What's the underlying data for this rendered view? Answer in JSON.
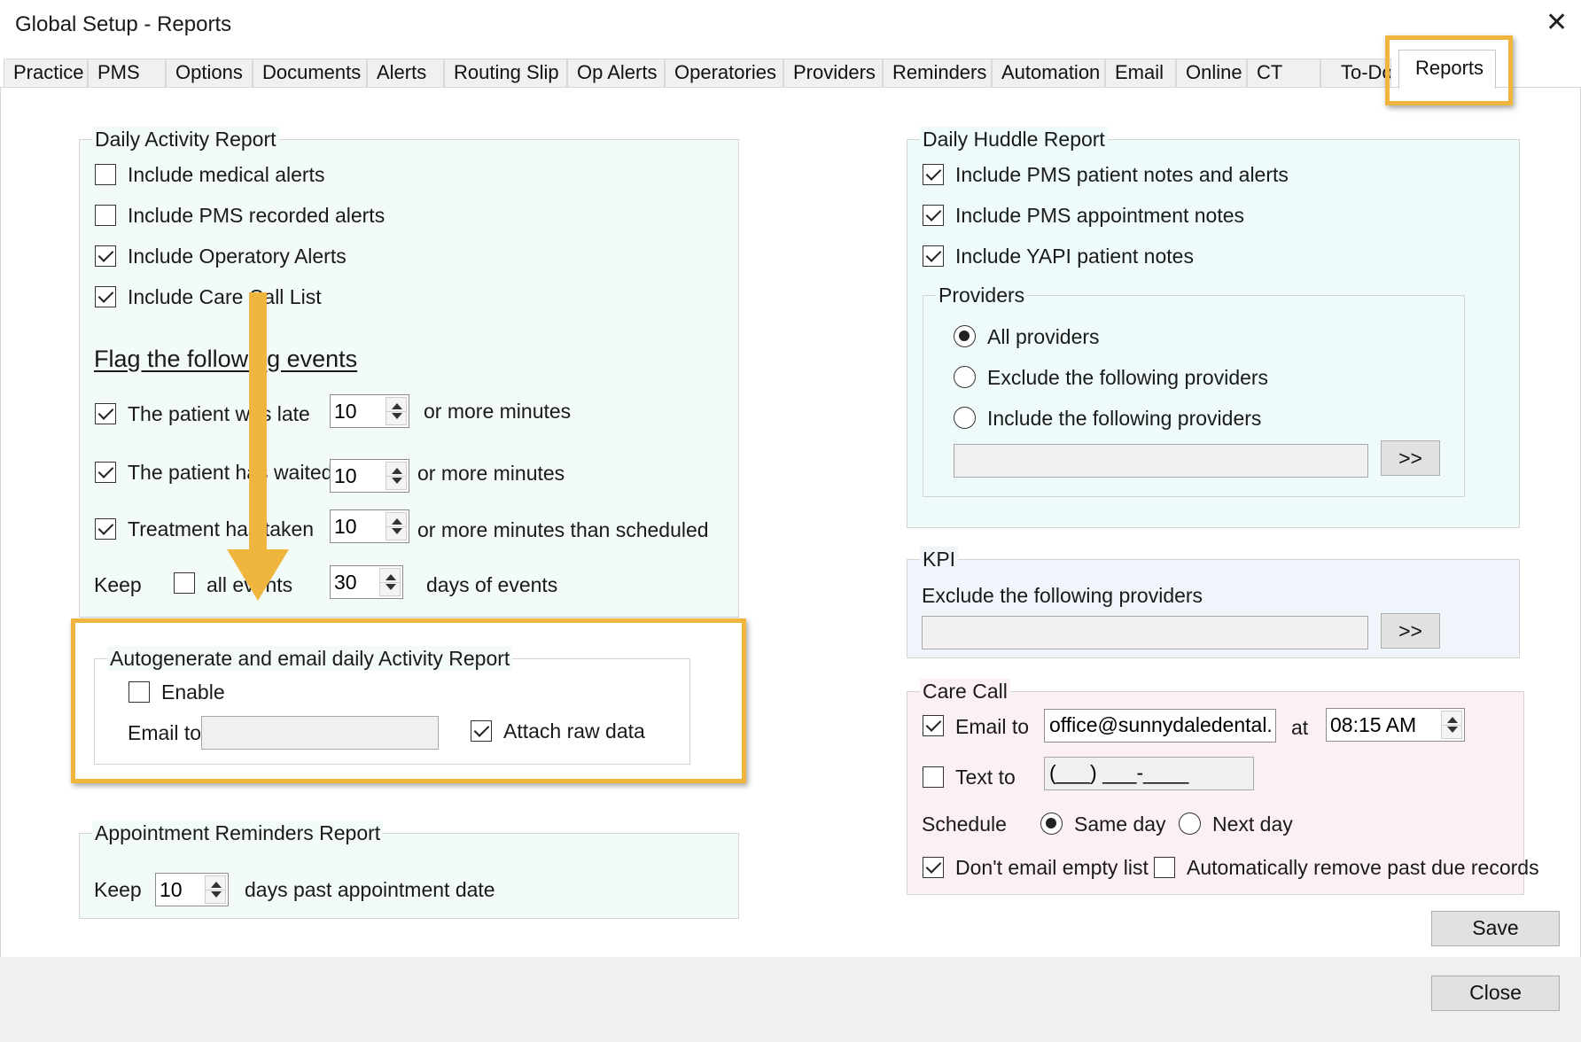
{
  "window": {
    "title": "Global Setup - Reports",
    "close_glyph": "✕"
  },
  "tabs": [
    "Practice",
    "PMS",
    "Options",
    "Documents",
    "Alerts",
    "Routing Slip",
    "Op Alerts",
    "Operatories",
    "Providers",
    "Reminders",
    "Automation",
    "Email",
    "Online",
    "CT",
    "To-Do",
    "Reports"
  ],
  "active_tab": "Reports",
  "daily_activity": {
    "legend": "Daily Activity Report",
    "checks": [
      {
        "label": "Include medical alerts",
        "checked": false
      },
      {
        "label": "Include PMS recorded alerts",
        "checked": false
      },
      {
        "label": "Include Operatory Alerts",
        "checked": true
      },
      {
        "label": "Include Care Call List",
        "checked": true
      }
    ],
    "flag_heading": "Flag the following events",
    "events": [
      {
        "label": "The patient was late",
        "checked": true,
        "value": "10",
        "suffix": "or more minutes"
      },
      {
        "label": "The patient has waited",
        "checked": true,
        "value": "10",
        "suffix": "or more minutes"
      },
      {
        "label": "Treatment has taken",
        "checked": true,
        "value": "10",
        "suffix": "or more minutes than scheduled"
      }
    ],
    "keep": {
      "label": "Keep",
      "all_events_label": "all events",
      "all_events_checked": false,
      "value": "30",
      "suffix": "days of events"
    }
  },
  "autogenerate": {
    "legend": "Autogenerate and email daily Activity Report",
    "enable_label": "Enable",
    "enable_checked": false,
    "email_label": "Email to",
    "email_value": "",
    "attach_label": "Attach raw data",
    "attach_checked": true
  },
  "appointment_reminders": {
    "legend": "Appointment Reminders Report",
    "keep_label": "Keep",
    "value": "10",
    "suffix": "days past appointment date"
  },
  "daily_huddle": {
    "legend": "Daily Huddle Report",
    "checks": [
      {
        "label": "Include PMS patient notes and alerts",
        "checked": true
      },
      {
        "label": "Include PMS appointment notes",
        "checked": true
      },
      {
        "label": "Include YAPI patient notes",
        "checked": true
      }
    ],
    "providers": {
      "legend": "Providers",
      "options": [
        {
          "label": "All providers",
          "selected": true
        },
        {
          "label": "Exclude the following providers",
          "selected": false
        },
        {
          "label": "Include the following providers",
          "selected": false
        }
      ],
      "field_value": "",
      "button": ">>"
    }
  },
  "kpi": {
    "legend": "KPI",
    "label": "Exclude the following providers",
    "field_value": "",
    "button": ">>"
  },
  "care_call": {
    "legend": "Care Call",
    "email_label": "Email to",
    "email_checked": true,
    "email_value": "office@sunnydaledental.com",
    "at_label": "at",
    "time_value": "08:15 AM",
    "text_label": "Text to",
    "text_checked": false,
    "phone_value": "(___) ___-____",
    "schedule_label": "Schedule",
    "schedule_options": [
      {
        "label": "Same day",
        "selected": true
      },
      {
        "label": "Next day",
        "selected": false
      }
    ],
    "dont_email_label": "Don't email empty list",
    "dont_email_checked": true,
    "auto_remove_label": "Automatically remove past due records",
    "auto_remove_checked": false
  },
  "buttons": {
    "save": "Save",
    "close": "Close"
  },
  "colors": {
    "highlight": "#f0b53e",
    "mint": "#f2fbf7",
    "cyan": "#effbfb",
    "blue": "#eff5fb",
    "pink": "#fbf0f2"
  }
}
